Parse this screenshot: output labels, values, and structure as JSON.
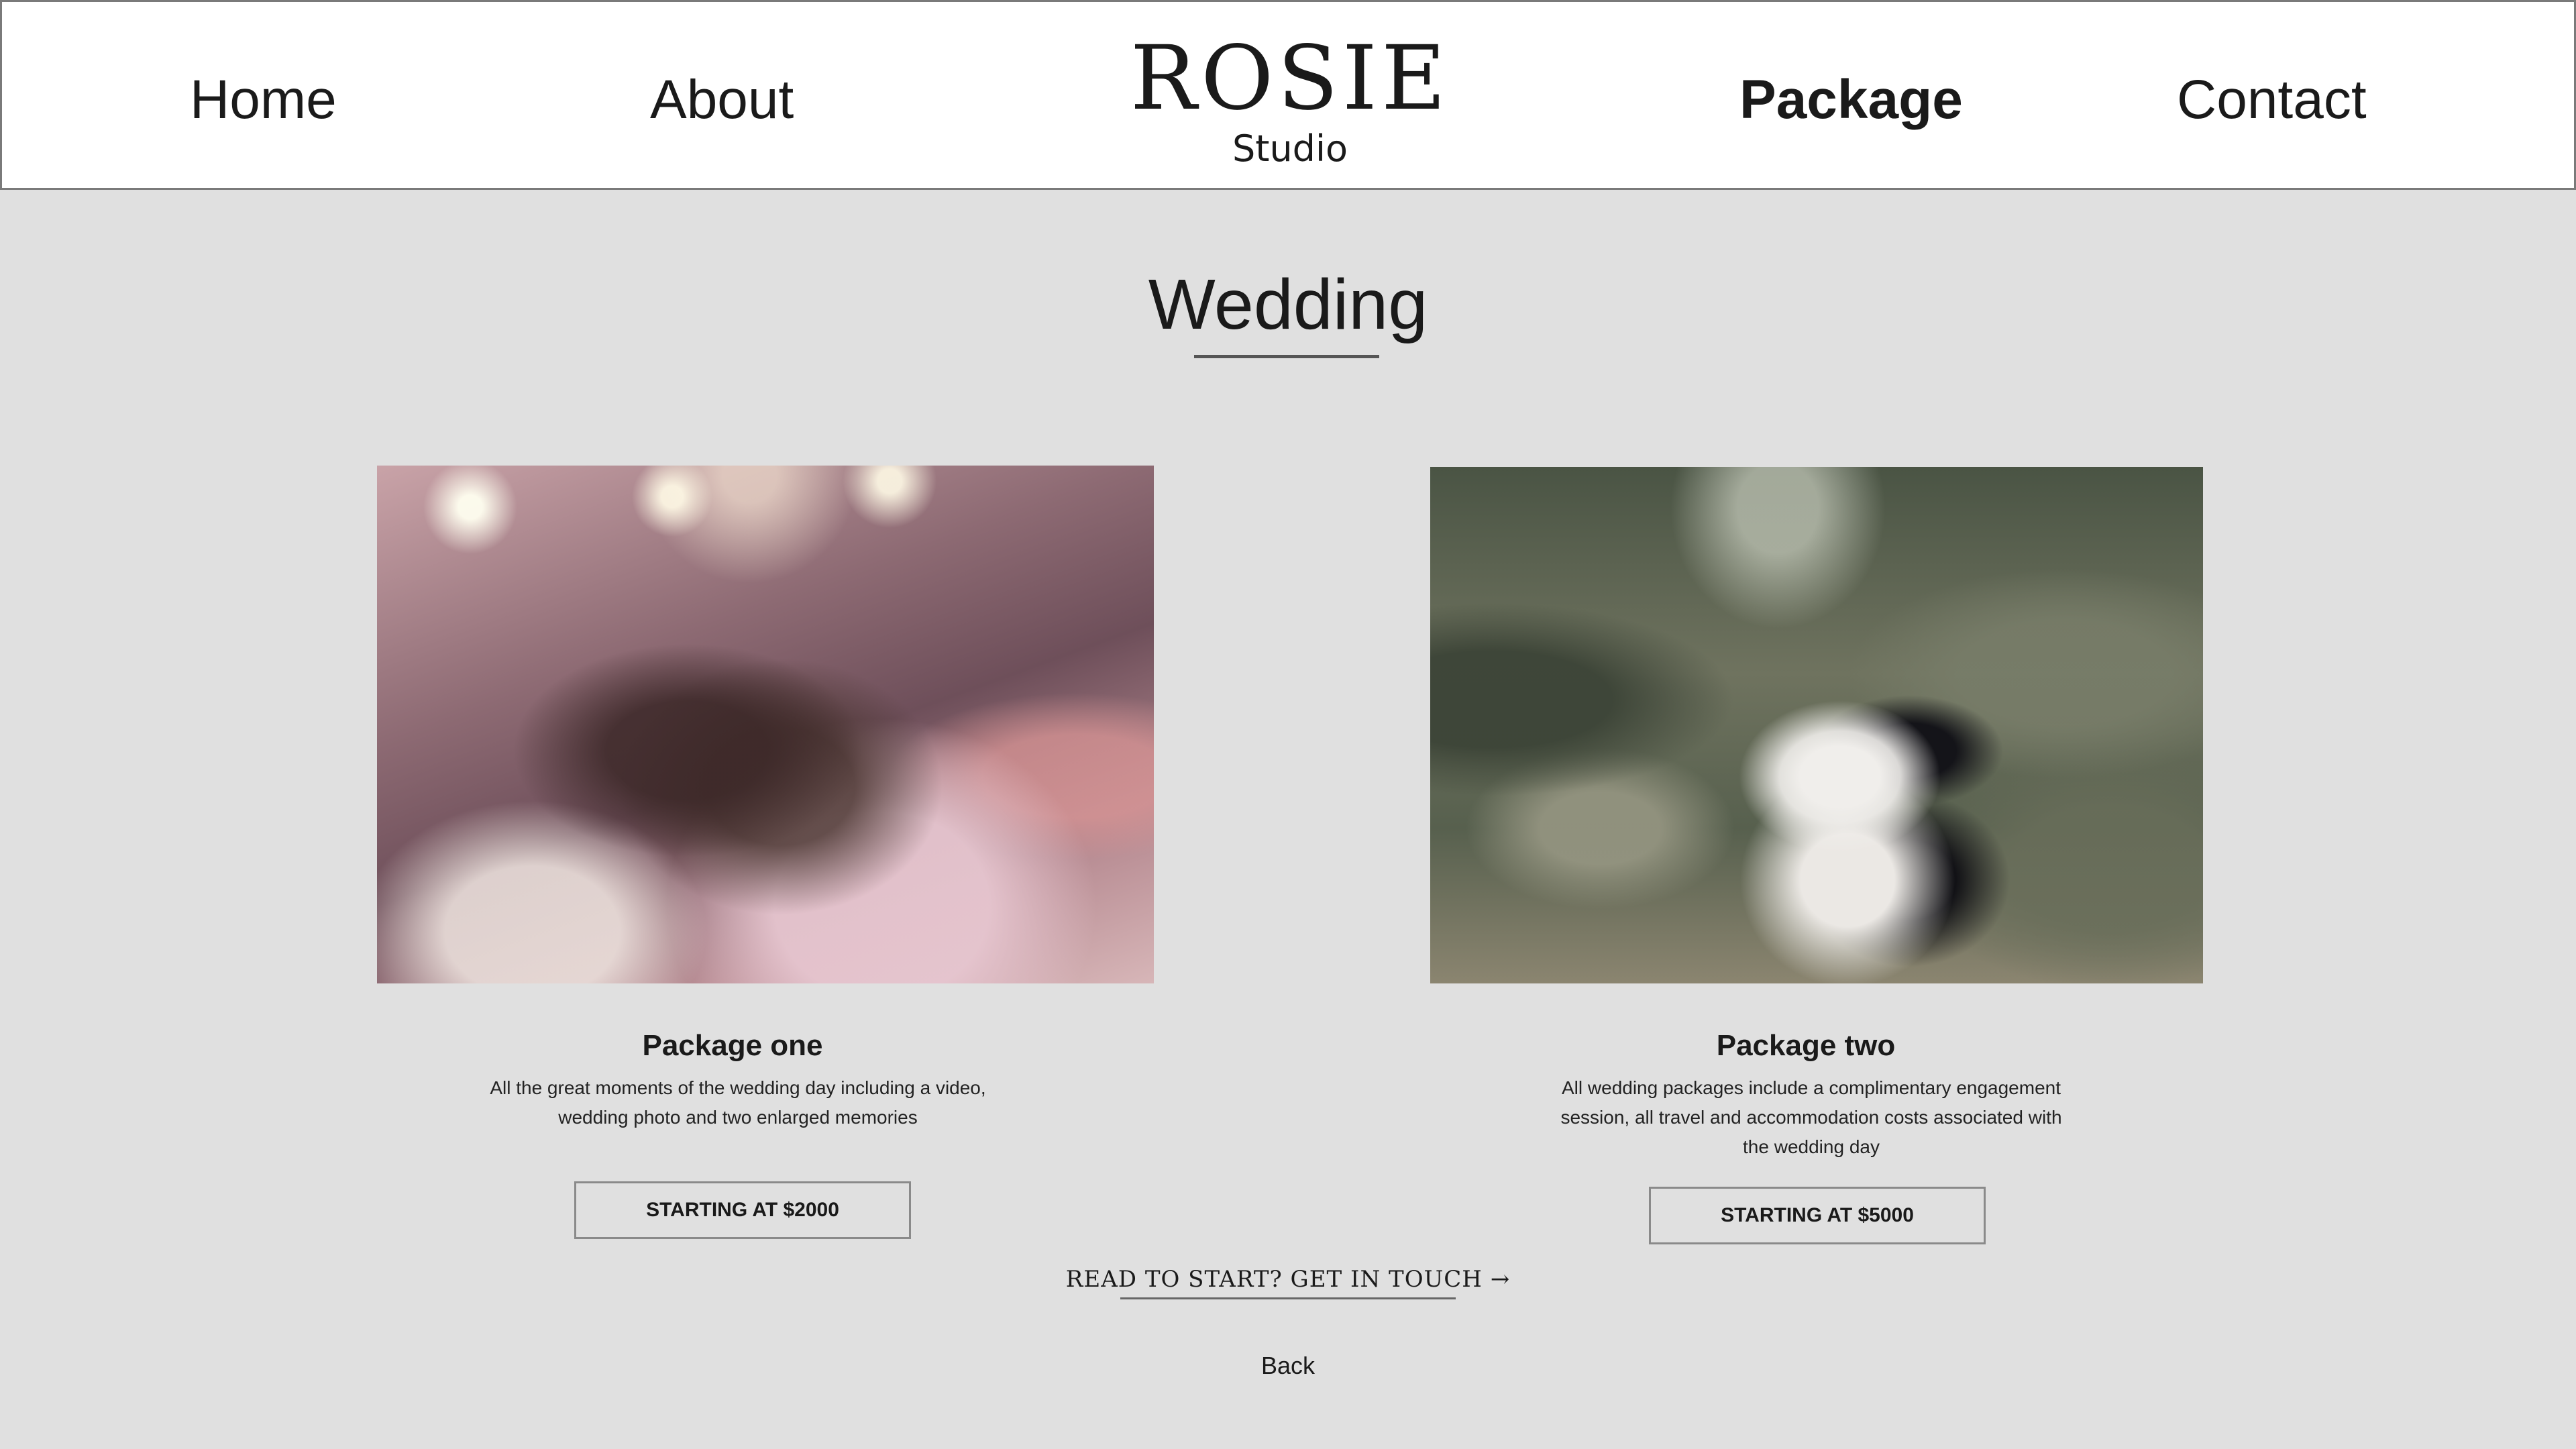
{
  "header": {
    "nav": {
      "home": "Home",
      "about": "About",
      "package": "Package",
      "contact": "Contact",
      "active": "package"
    },
    "logo": {
      "main": "ROSIE",
      "sub": "Studio"
    }
  },
  "main": {
    "title": "Wedding",
    "packages": [
      {
        "name": "Package one",
        "description": "All the great moments of the wedding day including a video, wedding photo and two enlarged memories",
        "price_label": "STARTING AT $2000"
      },
      {
        "name": "Package two",
        "description": "All wedding packages include a complimentary engagement session, all travel and accommodation costs associated with the wedding day",
        "price_label": "STARTING AT $5000"
      }
    ],
    "cta": "READ TO START? GET IN TOUCH",
    "cta_arrow": "→",
    "back": "Back"
  },
  "colors": {
    "page_background": "#e0e0e0",
    "header_background": "#ffffff",
    "text": "#1a1a1a",
    "border": "#8a8a8a"
  }
}
